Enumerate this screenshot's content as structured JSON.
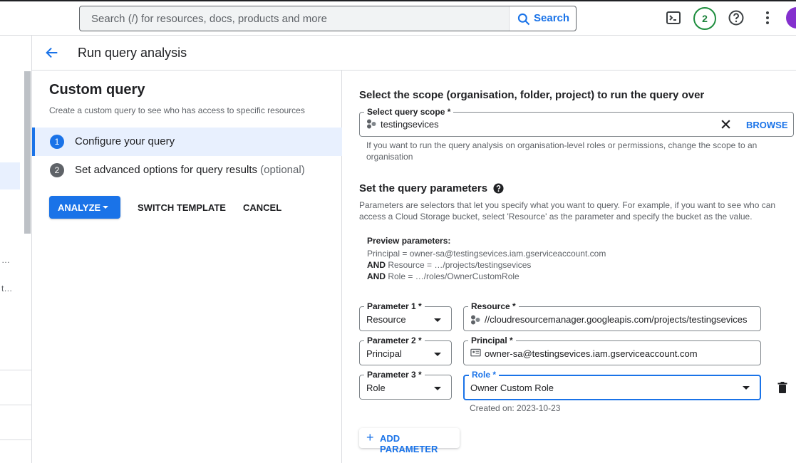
{
  "topbar": {
    "search_placeholder": "Search (/) for resources, docs, products and more",
    "search_button": "Search",
    "notification_count": "2"
  },
  "header": {
    "title": "Run query analysis"
  },
  "leftnav": {
    "truncated_items": [
      "…",
      "t…"
    ]
  },
  "left_panel": {
    "title": "Custom query",
    "description": "Create a custom query to see who has access to specific resources",
    "steps": [
      {
        "num": "1",
        "label": "Configure your query",
        "optional": ""
      },
      {
        "num": "2",
        "label": "Set advanced options for query results",
        "optional": "(optional)"
      }
    ],
    "analyze_button": "ANALYZE",
    "switch_template_button": "SWITCH TEMPLATE",
    "cancel_button": "CANCEL"
  },
  "right_panel": {
    "scope_heading": "Select the scope (organisation, folder, project) to run the query over",
    "scope_field_label": "Select query scope *",
    "scope_value": "testingsevices",
    "browse_button": "BROWSE",
    "scope_help": "If you want to run the query analysis on organisation-level roles or permissions, change the scope to an organisation",
    "params_heading": "Set the query parameters",
    "params_help": "Parameters are selectors that let you specify what you want to query. For example, if you want to see who can access a Cloud Storage bucket, select 'Resource' as the parameter and specify the bucket as the value.",
    "preview": {
      "title": "Preview parameters:",
      "line1": "Principal = owner-sa@testingsevices.iam.gserviceaccount.com",
      "line2_kw": "AND",
      "line2": " Resource = …/projects/testingsevices",
      "line3_kw": "AND",
      "line3": " Role = …/roles/OwnerCustomRole"
    },
    "parameters": [
      {
        "label": "Parameter 1 *",
        "value": "Resource",
        "value_label": "Resource *",
        "value_text": "//cloudresourcemanager.googleapis.com/projects/testingsevices"
      },
      {
        "label": "Parameter 2 *",
        "value": "Principal",
        "value_label": "Principal *",
        "value_text": "owner-sa@testingsevices.iam.gserviceaccount.com"
      },
      {
        "label": "Parameter 3 *",
        "value": "Role",
        "value_label": "Role *",
        "value_text": "Owner Custom Role"
      }
    ],
    "role_created": "Created on: 2023-10-23",
    "add_parameter_button": "ADD PARAMETER"
  },
  "colors": {
    "accent": "#1a73e8",
    "badge_green": "#1e8e3e",
    "avatar": "#8430ce"
  }
}
